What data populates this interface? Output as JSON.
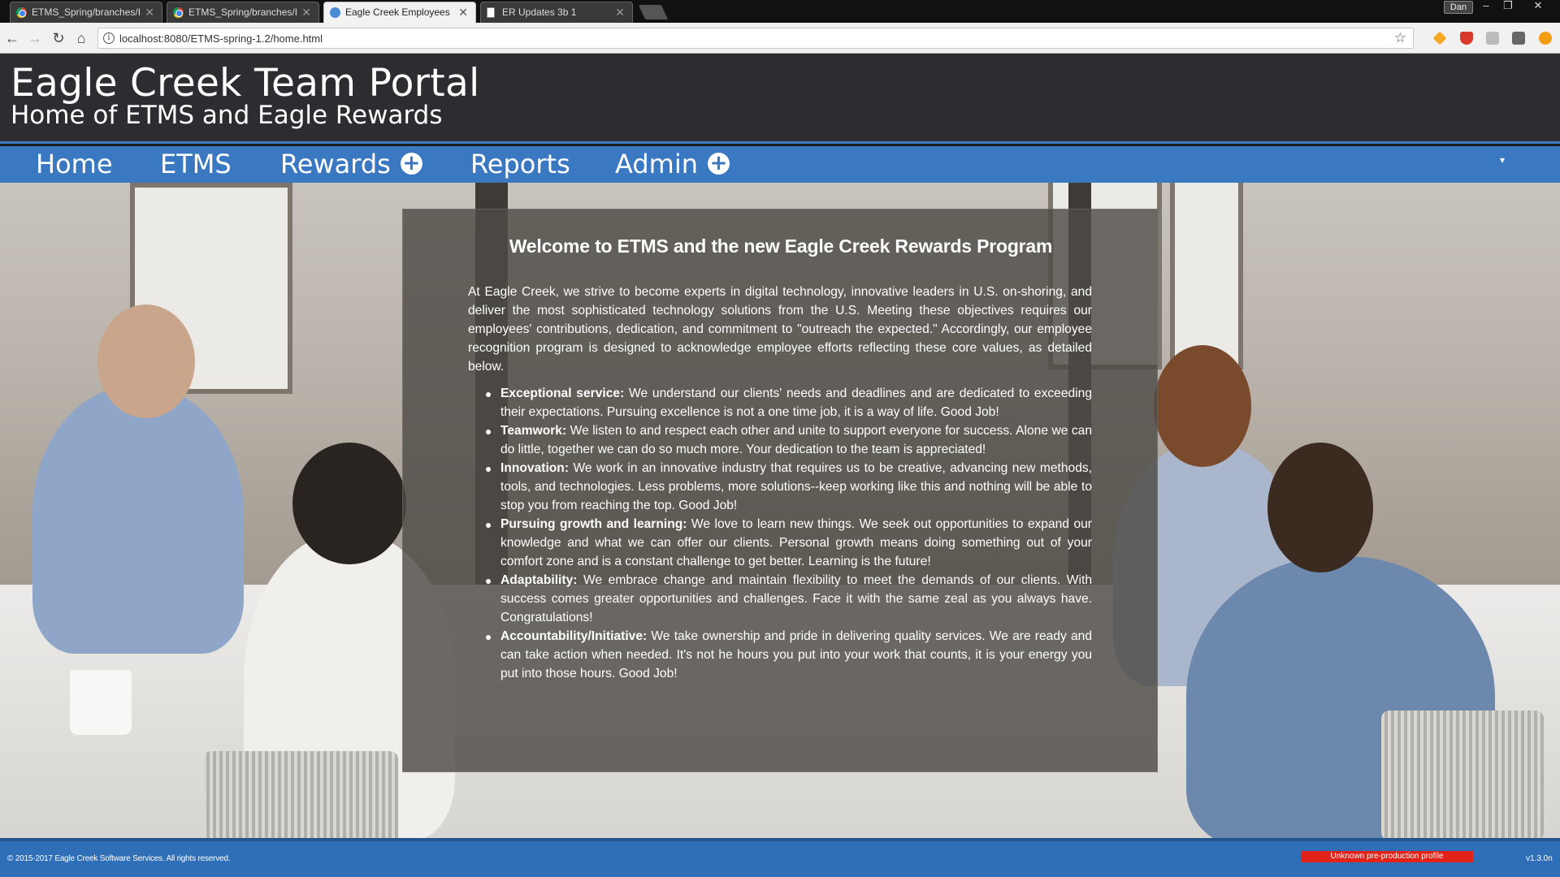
{
  "browser": {
    "tabs": [
      {
        "title": "ETMS_Spring/branches/I",
        "icon": "chrome-icon"
      },
      {
        "title": "ETMS_Spring/branches/I",
        "icon": "chrome-icon"
      },
      {
        "title": "Eagle Creek Employees",
        "icon": "globe-icon"
      },
      {
        "title": "ER Updates 3b 1",
        "icon": "page-icon"
      }
    ],
    "profile_name": "Dan",
    "url": "localhost:8080/ETMS-spring-1.2/home.html"
  },
  "header": {
    "title": "Eagle Creek Team Portal",
    "subtitle": "Home of ETMS and Eagle Rewards"
  },
  "nav": {
    "home": "Home",
    "etms": "ETMS",
    "rewards": "Rewards",
    "reports": "Reports",
    "admin": "Admin"
  },
  "welcome": {
    "heading": "Welcome to ETMS and the new Eagle Creek Rewards Program",
    "intro": "At Eagle Creek, we strive to become experts in digital technology, innovative leaders in U.S. on-shoring, and deliver the most sophisticated technology solutions from the U.S. Meeting these objectives requires our employees' contributions, dedication, and commitment to \"outreach the expected.\" Accordingly, our employee recognition program is designed to acknowledge employee efforts reflecting these core values, as detailed below.",
    "values": [
      {
        "name": "Exceptional service:",
        "text": " We understand our clients' needs and deadlines and are dedicated to exceeding their expectations. Pursuing excellence is not a one time job, it is a way of life. Good Job!"
      },
      {
        "name": "Teamwork:",
        "text": " We listen to and respect each other and unite to support everyone for success. Alone we can do little, together we can do so much more. Your dedication to the team is appreciated!"
      },
      {
        "name": "Innovation:",
        "text": " We work in an innovative industry that requires us to be creative, advancing new methods, tools, and technologies. Less problems, more solutions--keep working like this and nothing will be able to stop you from reaching the top. Good Job!"
      },
      {
        "name": "Pursuing growth and learning:",
        "text": " We love to learn new things. We seek out opportunities to expand our knowledge and what we can offer our clients. Personal growth means doing something out of your comfort zone and is a constant challenge to get better. Learning is the future!"
      },
      {
        "name": "Adaptability:",
        "text": " We embrace change and maintain flexibility to meet the demands of our clients. With success comes greater opportunities and challenges. Face it with the same zeal as you always have. Congratulations!"
      },
      {
        "name": "Accountability/Initiative:",
        "text": " We take ownership and pride in delivering quality services. We are ready and can take action when needed. It's not he hours you put into your work that counts, it is your energy you put into those hours. Good Job!"
      }
    ]
  },
  "footer": {
    "copyright": "© 2015-2017 Eagle Creek Software Services. All rights reserved.",
    "profile_badge": "Unknown pre-production profile",
    "version": "v1.3.0n"
  },
  "colors": {
    "nav_blue": "#3a78c2",
    "header_dark": "#2b2d31",
    "badge_red": "#e2231a"
  }
}
